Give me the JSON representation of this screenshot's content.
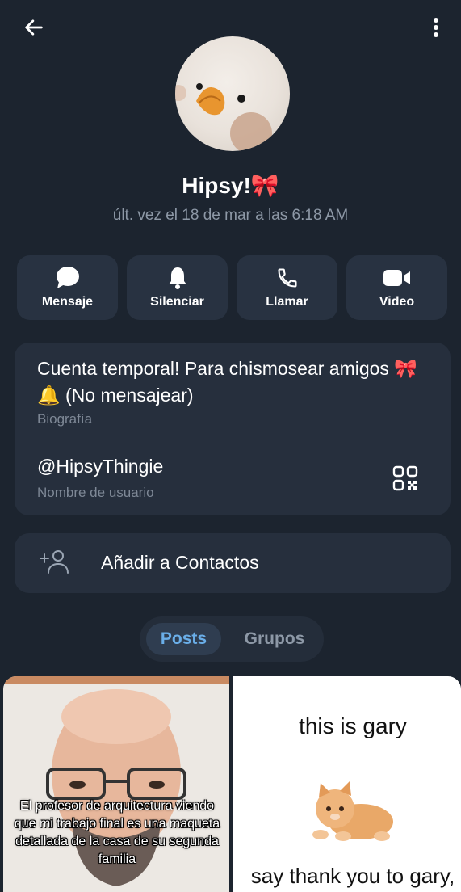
{
  "header": {
    "back_icon": "arrow-left-icon",
    "menu_icon": "more-vert-icon"
  },
  "profile": {
    "name": "Hipsy!🎀",
    "last_seen": "últ. vez el 18 de mar a las 6:18 AM"
  },
  "actions": [
    {
      "label": "Mensaje",
      "icon": "message-icon"
    },
    {
      "label": "Silenciar",
      "icon": "bell-icon"
    },
    {
      "label": "Llamar",
      "icon": "phone-icon"
    },
    {
      "label": "Video",
      "icon": "video-icon"
    }
  ],
  "info": {
    "bio": "Cuenta temporal! Para chismosear amigos 🎀🔔 (No mensajear)",
    "bio_label": "Biografía",
    "username": "@HipsyThingie",
    "username_label": "Nombre de usuario",
    "qr_icon": "qr-code-icon"
  },
  "add_contact": {
    "label": "Añadir a Contactos",
    "icon": "add-person-icon"
  },
  "tabs": [
    {
      "label": "Posts",
      "active": true
    },
    {
      "label": "Grupos",
      "active": false
    }
  ],
  "posts": [
    {
      "caption": "El profesor de arquitectura viendo que mi trabajo final es una maqueta detallada de la casa de su segunda familia"
    },
    {
      "title": "this is gary",
      "bottom": "say thank you to gary,"
    }
  ],
  "colors": {
    "background": "#1c242f",
    "card": "#262f3d",
    "accent": "#6aaee8"
  }
}
